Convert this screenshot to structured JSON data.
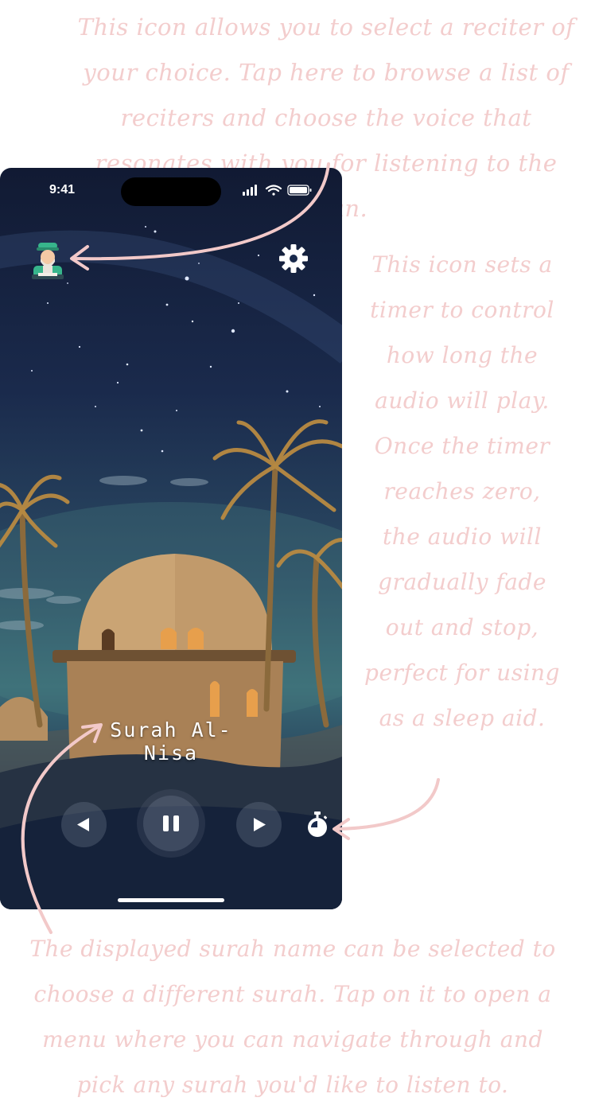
{
  "annotations": {
    "top": "This icon allows you to select a reciter of your choice. Tap here to browse a list of reciters and choose the voice that resonates with you for listening to the Quran.",
    "right": "This icon sets a timer to control how long the audio will play. Once the timer reaches zero, the audio will gradually fade out and stop, perfect for using as a sleep aid.",
    "bottom": "The displayed surah name can be selected to choose a different surah. Tap on it to open a menu where you can navigate through and pick any surah you'd like to listen to."
  },
  "status_bar": {
    "time": "9:41",
    "icons": [
      "signal-icon",
      "wifi-icon",
      "battery-icon"
    ]
  },
  "player": {
    "surah_name": "Surah Al-Nisa",
    "controls": [
      "previous-icon",
      "pause-icon",
      "next-icon",
      "timer-icon"
    ],
    "top_icons": [
      "reciter-icon",
      "gear-icon"
    ]
  },
  "colors": {
    "annotation_text": "#f3cdcd",
    "arrow": "#f2c9c9",
    "sky_top": "#111a33",
    "sky_horizon": "#3a6a76",
    "control_bg": "#6e788c"
  }
}
